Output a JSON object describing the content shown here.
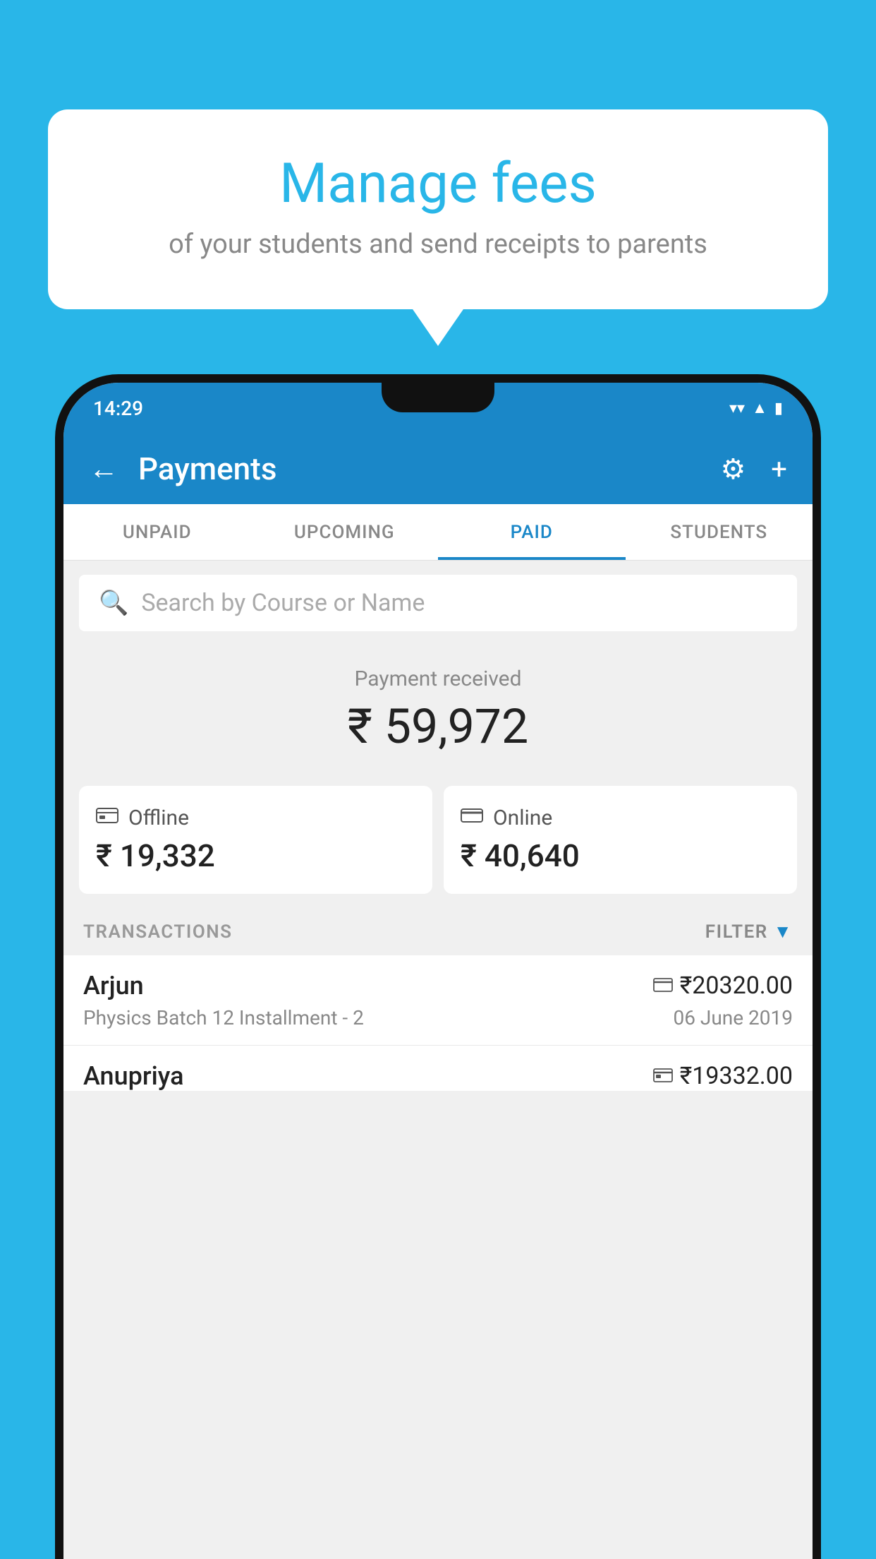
{
  "background_color": "#29b6e8",
  "bubble": {
    "title": "Manage fees",
    "subtitle": "of your students and send receipts to parents"
  },
  "status_bar": {
    "time": "14:29",
    "wifi_icon": "▼",
    "signal_icon": "▲",
    "battery_icon": "▮"
  },
  "app_bar": {
    "back_label": "←",
    "title": "Payments",
    "gear_label": "⚙",
    "plus_label": "+"
  },
  "tabs": [
    {
      "label": "UNPAID",
      "active": false
    },
    {
      "label": "UPCOMING",
      "active": false
    },
    {
      "label": "PAID",
      "active": true
    },
    {
      "label": "STUDENTS",
      "active": false
    }
  ],
  "search": {
    "placeholder": "Search by Course or Name"
  },
  "payment_received": {
    "label": "Payment received",
    "amount": "₹ 59,972"
  },
  "payment_cards": [
    {
      "type": "Offline",
      "amount": "₹ 19,332",
      "icon": "💳"
    },
    {
      "type": "Online",
      "amount": "₹ 40,640",
      "icon": "💳"
    }
  ],
  "transactions_section": {
    "label": "TRANSACTIONS",
    "filter_label": "FILTER"
  },
  "transactions": [
    {
      "name": "Arjun",
      "course": "Physics Batch 12 Installment - 2",
      "amount": "₹20320.00",
      "date": "06 June 2019",
      "payment_type": "online"
    },
    {
      "name": "Anupriya",
      "course": "",
      "amount": "₹19332.00",
      "date": "",
      "payment_type": "offline"
    }
  ]
}
